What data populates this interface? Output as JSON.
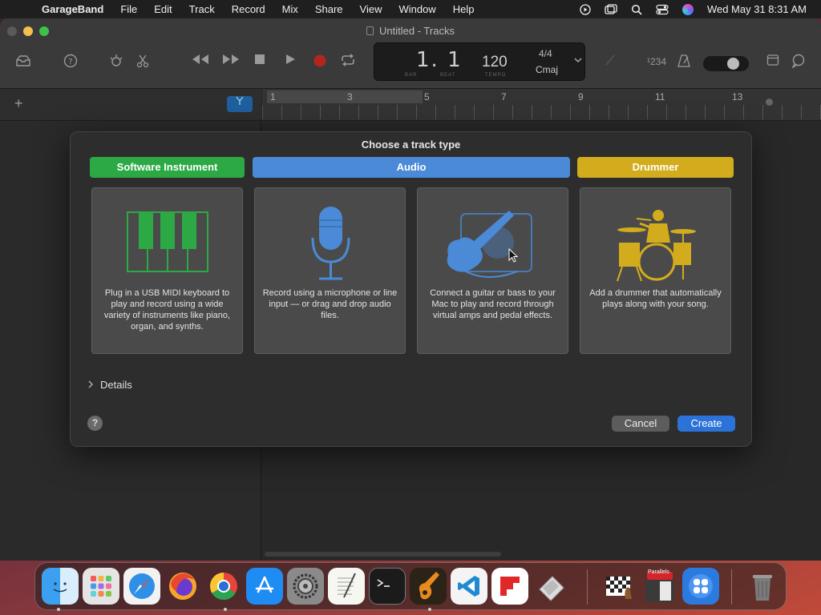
{
  "menubar": {
    "app": "GarageBand",
    "items": [
      "File",
      "Edit",
      "Track",
      "Record",
      "Mix",
      "Share",
      "View",
      "Window",
      "Help"
    ],
    "clock": "Wed May 31  8:31 AM"
  },
  "window": {
    "title": "Untitled - Tracks"
  },
  "lcd": {
    "position": "1. 1",
    "bar_label": "BAR",
    "beat_label": "BEAT",
    "tempo": "120",
    "tempo_label": "TEMPO",
    "time_signature": "4/4",
    "key": "Cmaj"
  },
  "toolbar": {
    "count_in": "¹234"
  },
  "ruler": {
    "markers": [
      "1",
      "3",
      "5",
      "7",
      "9",
      "11",
      "13"
    ]
  },
  "dialog": {
    "title": "Choose a track type",
    "categories": {
      "software_instrument": "Software Instrument",
      "audio": "Audio",
      "drummer": "Drummer"
    },
    "cards": [
      {
        "description": "Plug in a USB MIDI keyboard to play and record using a wide variety of instruments like piano, organ, and synths."
      },
      {
        "description": "Record using a microphone or line input — or drag and drop audio files."
      },
      {
        "description": "Connect a guitar or bass to your Mac to play and record through virtual amps and pedal effects."
      },
      {
        "description": "Add a drummer that automatically plays along with your song."
      }
    ],
    "details_label": "Details",
    "help_label": "?",
    "cancel_label": "Cancel",
    "create_label": "Create"
  },
  "colors": {
    "software_instrument": "#2ca945",
    "audio": "#4a8ad6",
    "drummer": "#d2ac1c",
    "create_button": "#2b73d8"
  },
  "dock": {
    "apps": [
      "finder-icon",
      "launchpad-icon",
      "safari-icon",
      "firefox-icon",
      "chrome-icon",
      "app-store-icon",
      "system-settings-icon",
      "textedit-icon",
      "terminal-icon",
      "garageband-icon",
      "vscode-icon",
      "flipboard-icon",
      "preview-icon",
      "chess-icon",
      "parallels-icon",
      "parallels-apps-icon",
      "trash-icon"
    ],
    "parallels_badge": "Parallels"
  }
}
